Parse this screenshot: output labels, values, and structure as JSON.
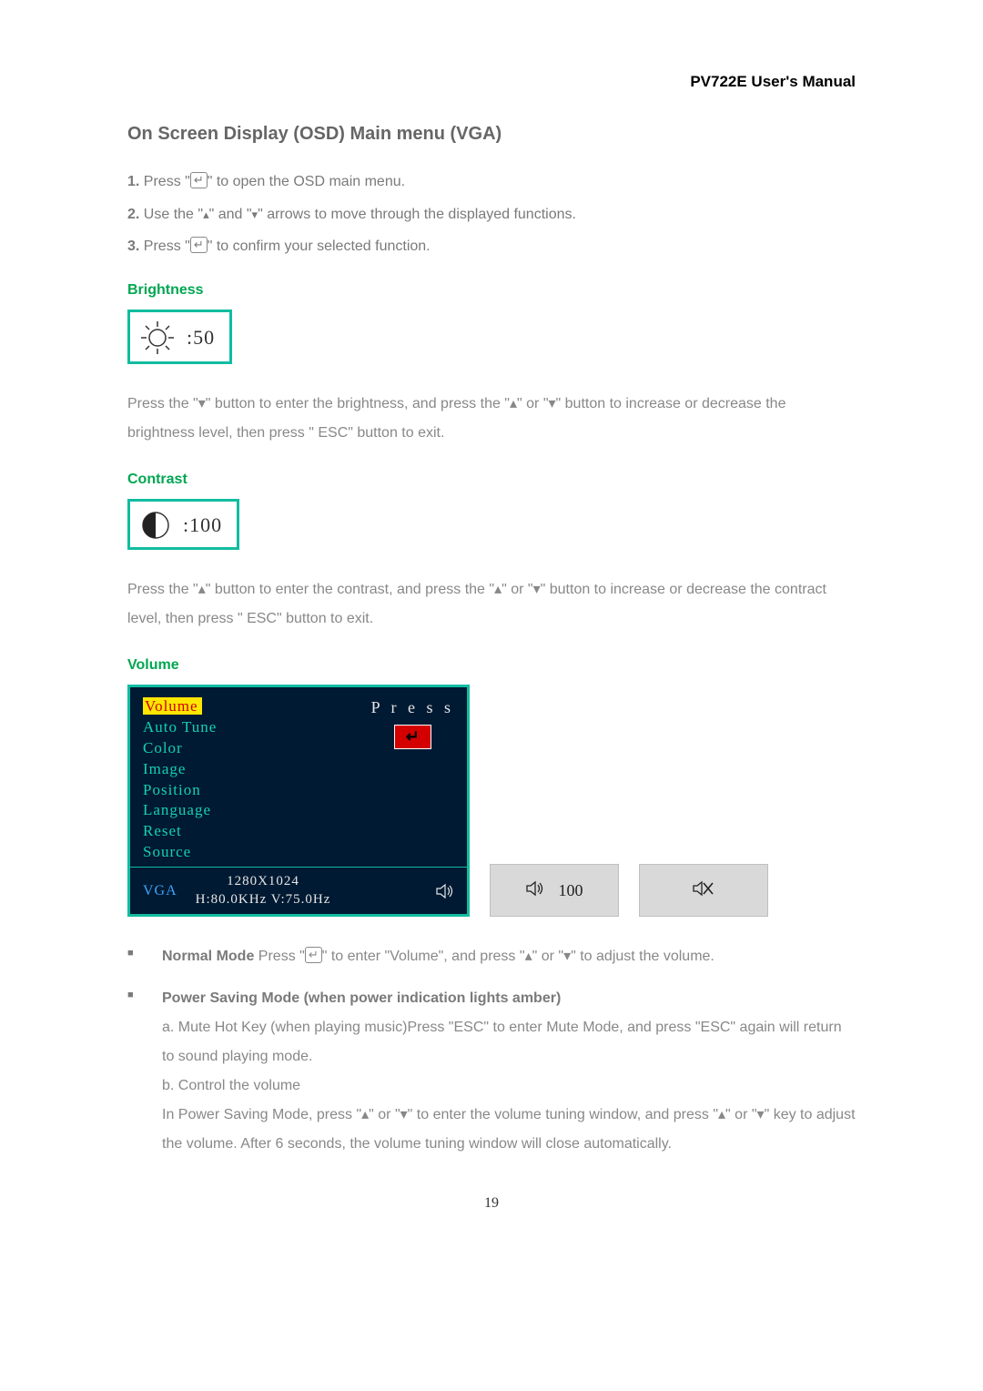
{
  "header": {
    "title": "PV722E User's Manual"
  },
  "section": {
    "title": "On Screen Display (OSD) Main menu (VGA)"
  },
  "steps": {
    "s1a": "1.",
    "s1b": " Press \"",
    "s1c": "\" to open the OSD main menu.",
    "s2a": "2.",
    "s2b": " Use the \"",
    "s2c": "\" and \"",
    "s2d": "\" arrows to move through the displayed functions.",
    "s3a": "3.",
    "s3b": " Press \"",
    "s3c": "\" to confirm your selected function."
  },
  "brightness": {
    "label": "Brightness",
    "value": ":50",
    "desc_a": "Press the \"",
    "desc_b": "\" button to enter the brightness, and press the \"",
    "desc_c": "\" or \"",
    "desc_d": "\" button to increase or decrease the brightness level, then press \" ESC\" button to exit."
  },
  "contrast": {
    "label": "Contrast",
    "value": ":100",
    "desc_a": "Press the \"",
    "desc_b": "\" button to enter the contrast, and press the \"",
    "desc_c": "\" or \"",
    "desc_d": "\" button to increase or decrease the contract level, then press \" ESC\" button to exit."
  },
  "volume": {
    "label": "Volume",
    "menu": {
      "items": [
        "Volume",
        "Auto Tune",
        "Color",
        "Image",
        "Position",
        "Language",
        "Reset",
        "Source"
      ],
      "highlighted": "Volume",
      "press_label": "P r e s s",
      "source": "VGA",
      "resolution_line1": "1280X1024",
      "resolution_line2": "H:80.0KHz  V:75.0Hz"
    },
    "side_volume_value": "100"
  },
  "bullets": {
    "normal_a": "Normal Mode",
    "normal_b": " Press \"",
    "normal_c": "\" to enter \"Volume\", and press \"",
    "normal_d": "\" or \"",
    "normal_e": "\" to adjust the volume.",
    "power_title": "Power Saving Mode (when power indication lights amber)",
    "power_a": "a. Mute Hot Key (when playing music)Press \"ESC\" to enter Mute Mode, and press \"ESC\" again will return to sound playing mode.",
    "power_b": "b. Control the volume",
    "power_c1": "In Power Saving Mode, press \"",
    "power_c2": "\" or \"",
    "power_c3": "\" to enter the volume tuning window, and press \"",
    "power_c4": "\" or \"",
    "power_c5": "\" key to adjust the volume. After 6 seconds, the volume tuning window will close automatically."
  },
  "page_number": "19",
  "glyph": {
    "up": "▴",
    "down": "▾",
    "enter": "↵",
    "square": "■"
  }
}
